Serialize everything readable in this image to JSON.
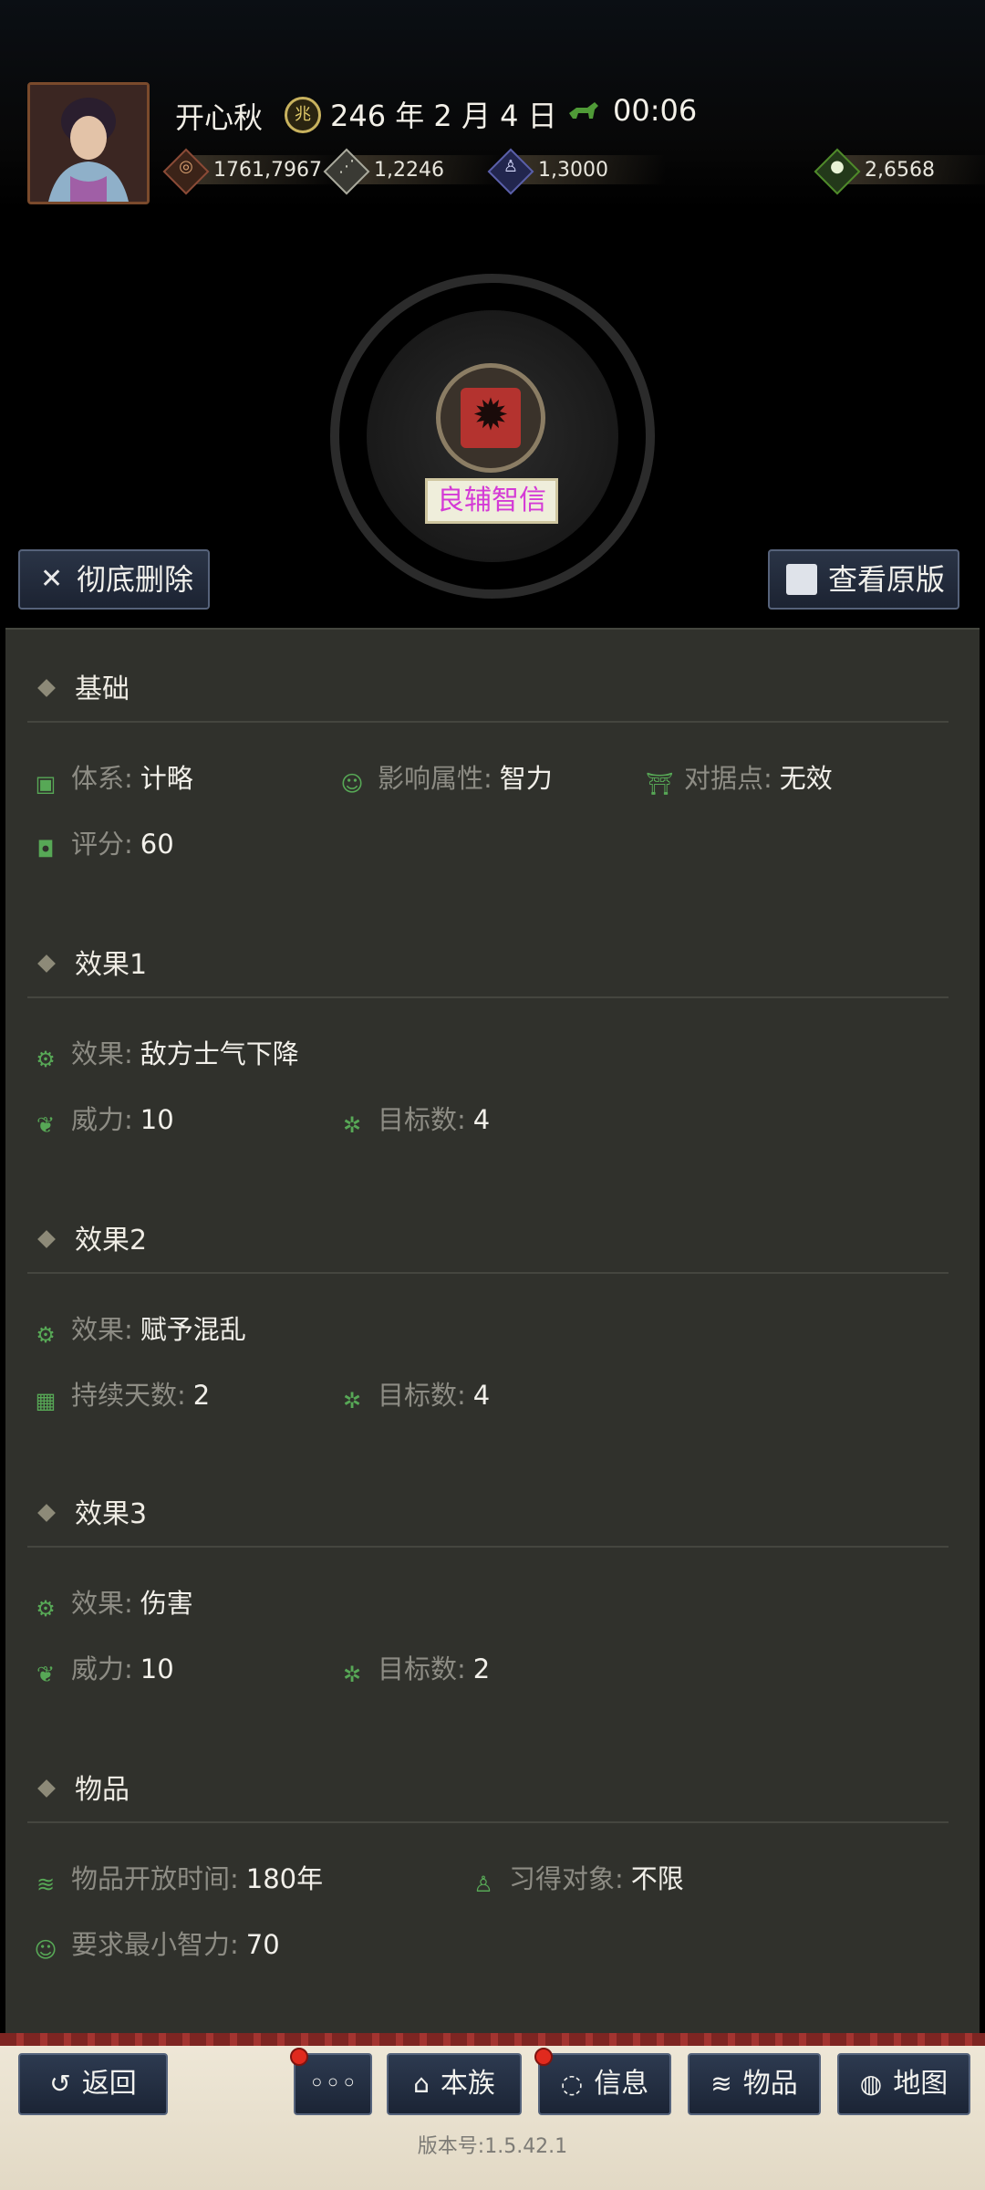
{
  "header": {
    "player_name": "开心秋",
    "date_icon": "calendar-seal-icon",
    "date": "246 年 2 月 4 日",
    "time": "00:06",
    "resources": [
      {
        "name": "gold",
        "icon": "coin-icon",
        "value": "1761,7967",
        "color": "#8a4a36"
      },
      {
        "name": "food",
        "icon": "grain-icon",
        "value": "1,2246",
        "color": "#a9a99c"
      },
      {
        "name": "troops",
        "icon": "soldier-icon",
        "value": "1,3000",
        "color": "#5a5fa8"
      },
      {
        "name": "money",
        "icon": "money-bag-icon",
        "value": "2,6568",
        "color": "#4f8a2a"
      }
    ]
  },
  "skill": {
    "name": "良辅智信",
    "icon": "skill-icon"
  },
  "actions": {
    "delete_label": "彻底删除",
    "view_label": "查看原版"
  },
  "sections": {
    "basic": {
      "title": "基础",
      "system_label": "体系:",
      "system_value": "计略",
      "attr_label": "影响属性:",
      "attr_value": "智力",
      "stronghold_label": "对据点:",
      "stronghold_value": "无效",
      "score_label": "评分:",
      "score_value": "60"
    },
    "effect1": {
      "title": "效果1",
      "effect_label": "效果:",
      "effect_value": "敌方士气下降",
      "power_label": "威力:",
      "power_value": "10",
      "targets_label": "目标数:",
      "targets_value": "4"
    },
    "effect2": {
      "title": "效果2",
      "effect_label": "效果:",
      "effect_value": "赋予混乱",
      "duration_label": "持续天数:",
      "duration_value": "2",
      "targets_label": "目标数:",
      "targets_value": "4"
    },
    "effect3": {
      "title": "效果3",
      "effect_label": "效果:",
      "effect_value": "伤害",
      "power_label": "威力:",
      "power_value": "10",
      "targets_label": "目标数:",
      "targets_value": "2"
    },
    "item": {
      "title": "物品",
      "open_label": "物品开放时间:",
      "open_value": "180年",
      "learner_label": "习得对象:",
      "learner_value": "不限",
      "minint_label": "要求最小智力:",
      "minint_value": "70"
    }
  },
  "nav": {
    "back": "返回",
    "more": "◦◦◦",
    "clan": "本族",
    "info": "信息",
    "items": "物品",
    "map": "地图"
  },
  "version": "版本号:1.5.42.1"
}
